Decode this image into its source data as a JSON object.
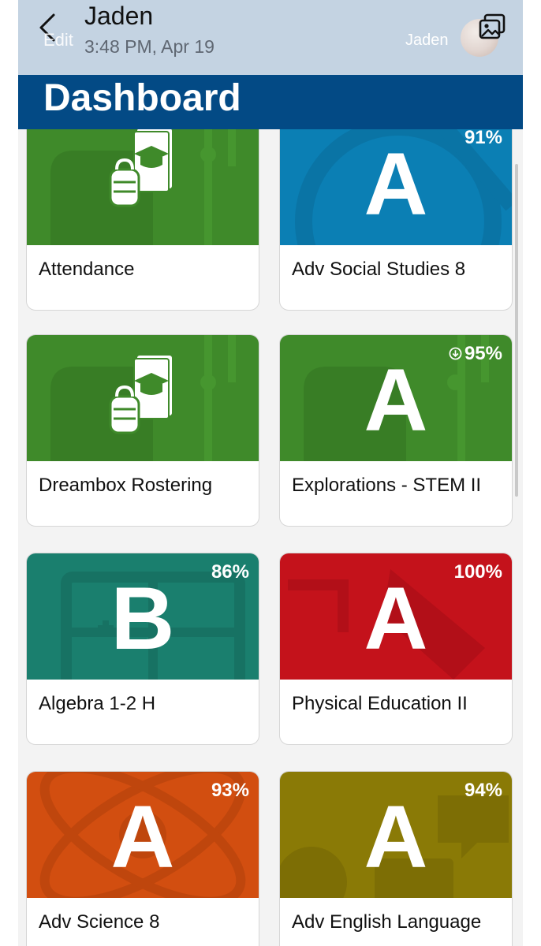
{
  "header": {
    "back_icon": "chevron-left-icon",
    "edit_label": "Edit",
    "sender_name": "Jaden",
    "timestamp": "3:48 PM, Apr 19",
    "user_name": "Jaden",
    "gallery_icon": "photo-gallery-icon",
    "background": "#c4d3e2"
  },
  "dashboard": {
    "title": "Dashboard",
    "banner_color": "#034a85"
  },
  "cards": [
    {
      "title": "Attendance",
      "grade": "",
      "percent": "",
      "color": "#3f8a2a",
      "icon": "backpack-book-icon"
    },
    {
      "title": "Adv Social Studies 8",
      "grade": "A",
      "percent": "91%",
      "color": "#0b7fb4"
    },
    {
      "title": "Dreambox Rostering",
      "grade": "",
      "percent": "",
      "color": "#3f8a2a",
      "icon": "backpack-book-icon"
    },
    {
      "title": "Explorations - STEM II",
      "grade": "A",
      "percent": "95%",
      "color": "#3f8a2a",
      "status_icon": "download-icon"
    },
    {
      "title": "Algebra 1-2 H",
      "grade": "B",
      "percent": "86%",
      "color": "#1a7f6e"
    },
    {
      "title": "Physical Education II",
      "grade": "A",
      "percent": "100%",
      "color": "#c4121b"
    },
    {
      "title": "Adv Science 8",
      "grade": "A",
      "percent": "93%",
      "color": "#d24e10"
    },
    {
      "title": "Adv English Language",
      "grade": "A",
      "percent": "94%",
      "color": "#8a7a06"
    }
  ]
}
